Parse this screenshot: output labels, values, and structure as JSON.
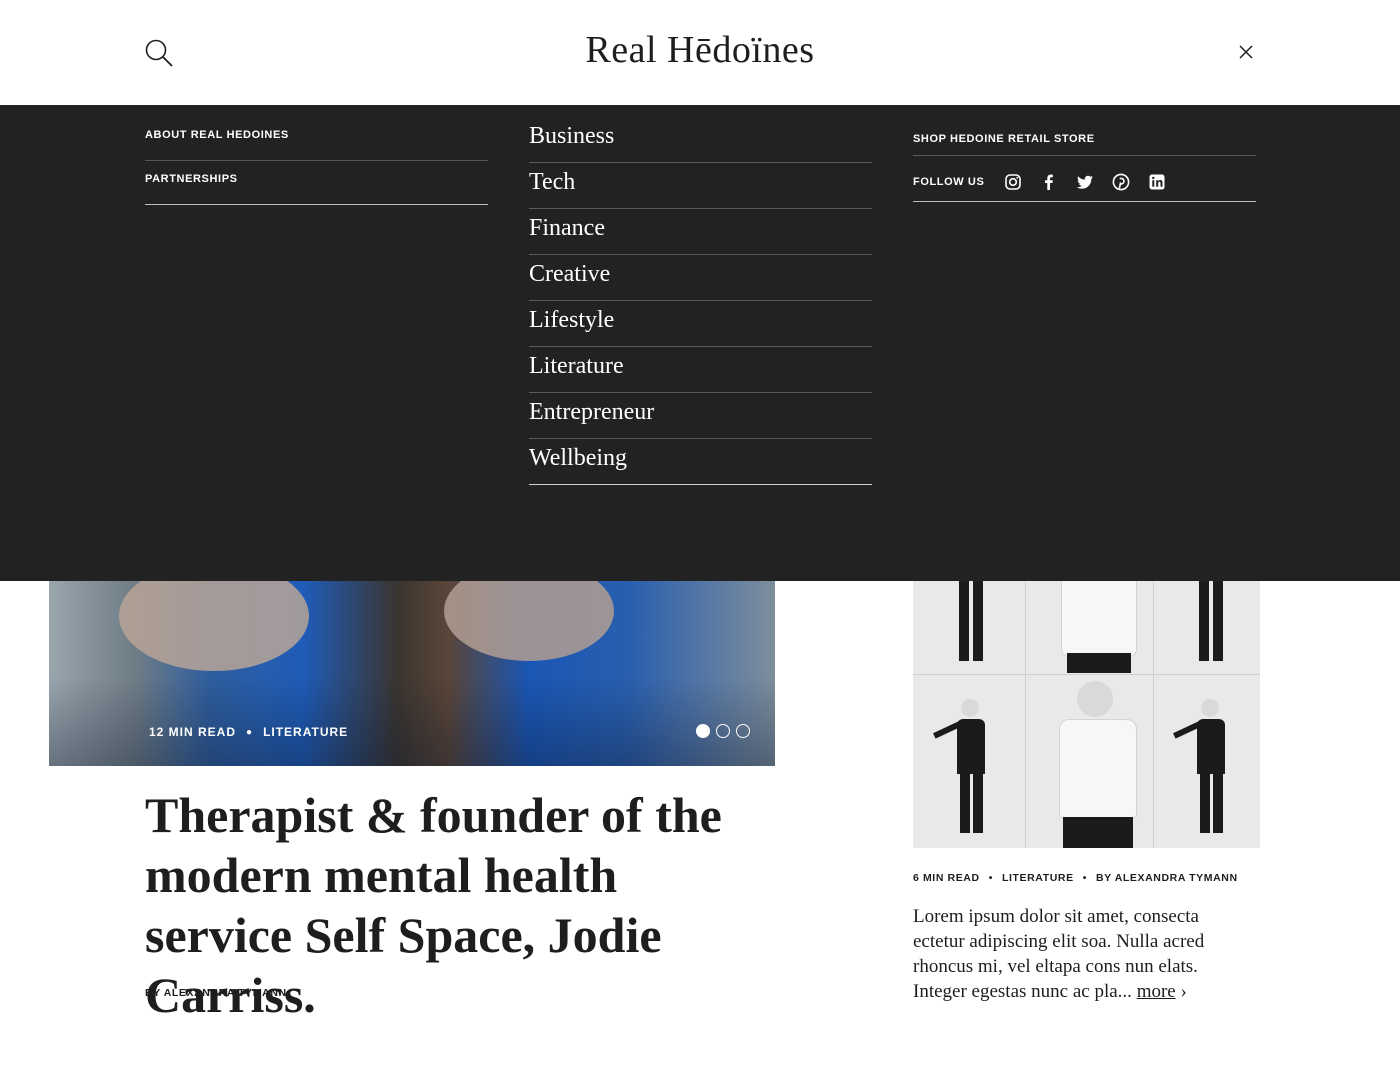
{
  "header": {
    "brand": "Real Hēdoïnes"
  },
  "menu": {
    "left_links": [
      {
        "label": "ABOUT REAL HEDOINES"
      },
      {
        "label": "PARTNERSHIPS"
      }
    ],
    "categories": [
      {
        "label": "Business"
      },
      {
        "label": "Tech"
      },
      {
        "label": "Finance"
      },
      {
        "label": "Creative"
      },
      {
        "label": "Lifestyle"
      },
      {
        "label": "Literature"
      },
      {
        "label": "Entrepreneur"
      },
      {
        "label": "Wellbeing"
      }
    ],
    "shop_label": "SHOP HEDOINE RETAIL STORE",
    "follow_label": "FOLLOW US",
    "social_icons": [
      "instagram-icon",
      "facebook-icon",
      "twitter-icon",
      "pinterest-icon",
      "linkedin-icon"
    ]
  },
  "featured": {
    "read_time": "12 MIN READ",
    "category": "LITERATURE",
    "carousel_count": 3,
    "carousel_active": 1,
    "title": "Therapist & founder of the modern mental health service Self Space, Jodie Carriss.",
    "byline": "BY ALEXANDRA TYMANN"
  },
  "side_article": {
    "read_time": "6 MIN READ",
    "category": "LITERATURE",
    "byline": "BY ALEXANDRA TYMANN",
    "excerpt": "Lorem ipsum dolor sit amet, consecta ectetur adipiscing elit soa. Nulla acred rhoncus mi, vel eltapa cons nun elats. Integer egestas nunc ac pla... ",
    "more_label": "more",
    "more_arrow": "›"
  },
  "colors": {
    "overlay_bg": "#222222",
    "text_dark": "#1e1e1e",
    "accent_blue": "#1f5cb8"
  }
}
